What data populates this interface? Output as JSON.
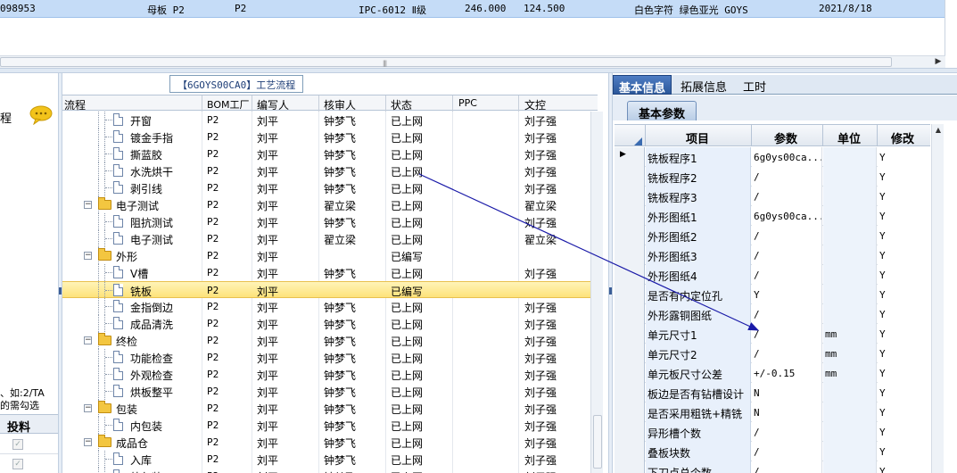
{
  "top_row": {
    "code": "098953",
    "name": "母板  P2",
    "factory": "P2",
    "material": "IPC-6012 Ⅱ级",
    "length": "246.000",
    "width": "124.500",
    "silk": "白色字符  绿色亚光  GOYS",
    "date": "2021/8/18"
  },
  "left_panel": {
    "label": "程",
    "note_line1": "、如:2/TA",
    "note_line2": "的需勾选",
    "column_header": "投料",
    "checks": [
      "✓",
      "✓"
    ]
  },
  "middle": {
    "title": "【6GOYS00CA0】工艺流程",
    "columns": [
      "流程",
      "BOM工厂",
      "编写人",
      "核审人",
      "状态",
      "PPC",
      "文控"
    ],
    "rows": [
      {
        "type": "child",
        "name": "开窗",
        "bom": "P2",
        "writer": "刘平",
        "reviewer": "钟梦飞",
        "status": "已上网",
        "ppc": "",
        "doc": "刘子强",
        "selected": false
      },
      {
        "type": "child",
        "name": "镀金手指",
        "bom": "P2",
        "writer": "刘平",
        "reviewer": "钟梦飞",
        "status": "已上网",
        "ppc": "",
        "doc": "刘子强",
        "selected": false
      },
      {
        "type": "child",
        "name": "撕蓝胶",
        "bom": "P2",
        "writer": "刘平",
        "reviewer": "钟梦飞",
        "status": "已上网",
        "ppc": "",
        "doc": "刘子强",
        "selected": false
      },
      {
        "type": "child",
        "name": "水洗烘干",
        "bom": "P2",
        "writer": "刘平",
        "reviewer": "钟梦飞",
        "status": "已上网",
        "ppc": "",
        "doc": "刘子强",
        "selected": false
      },
      {
        "type": "child",
        "name": "剥引线",
        "bom": "P2",
        "writer": "刘平",
        "reviewer": "钟梦飞",
        "status": "已上网",
        "ppc": "",
        "doc": "刘子强",
        "selected": false
      },
      {
        "type": "folder",
        "name": "电子测试",
        "bom": "P2",
        "writer": "刘平",
        "reviewer": "翟立梁",
        "status": "已上网",
        "ppc": "",
        "doc": "翟立梁",
        "selected": false
      },
      {
        "type": "child",
        "name": "阻抗测试",
        "bom": "P2",
        "writer": "刘平",
        "reviewer": "钟梦飞",
        "status": "已上网",
        "ppc": "",
        "doc": "刘子强",
        "selected": false
      },
      {
        "type": "child",
        "name": "电子测试",
        "bom": "P2",
        "writer": "刘平",
        "reviewer": "翟立梁",
        "status": "已上网",
        "ppc": "",
        "doc": "翟立梁",
        "selected": false
      },
      {
        "type": "folder",
        "name": "外形",
        "bom": "P2",
        "writer": "刘平",
        "reviewer": "",
        "status": "已编写",
        "ppc": "",
        "doc": "",
        "selected": false
      },
      {
        "type": "child",
        "name": "V槽",
        "bom": "P2",
        "writer": "刘平",
        "reviewer": "钟梦飞",
        "status": "已上网",
        "ppc": "",
        "doc": "刘子强",
        "selected": false
      },
      {
        "type": "child",
        "name": "铣板",
        "bom": "P2",
        "writer": "刘平",
        "reviewer": "",
        "status": "已编写",
        "ppc": "",
        "doc": "",
        "selected": true
      },
      {
        "type": "child",
        "name": "金指倒边",
        "bom": "P2",
        "writer": "刘平",
        "reviewer": "钟梦飞",
        "status": "已上网",
        "ppc": "",
        "doc": "刘子强",
        "selected": false
      },
      {
        "type": "child",
        "name": "成品清洗",
        "bom": "P2",
        "writer": "刘平",
        "reviewer": "钟梦飞",
        "status": "已上网",
        "ppc": "",
        "doc": "刘子强",
        "selected": false
      },
      {
        "type": "folder",
        "name": "终检",
        "bom": "P2",
        "writer": "刘平",
        "reviewer": "钟梦飞",
        "status": "已上网",
        "ppc": "",
        "doc": "刘子强",
        "selected": false
      },
      {
        "type": "child",
        "name": "功能检查",
        "bom": "P2",
        "writer": "刘平",
        "reviewer": "钟梦飞",
        "status": "已上网",
        "ppc": "",
        "doc": "刘子强",
        "selected": false
      },
      {
        "type": "child",
        "name": "外观检查",
        "bom": "P2",
        "writer": "刘平",
        "reviewer": "钟梦飞",
        "status": "已上网",
        "ppc": "",
        "doc": "刘子强",
        "selected": false
      },
      {
        "type": "child",
        "name": "烘板整平",
        "bom": "P2",
        "writer": "刘平",
        "reviewer": "钟梦飞",
        "status": "已上网",
        "ppc": "",
        "doc": "刘子强",
        "selected": false
      },
      {
        "type": "folder",
        "name": "包装",
        "bom": "P2",
        "writer": "刘平",
        "reviewer": "钟梦飞",
        "status": "已上网",
        "ppc": "",
        "doc": "刘子强",
        "selected": false
      },
      {
        "type": "child",
        "name": "内包装",
        "bom": "P2",
        "writer": "刘平",
        "reviewer": "钟梦飞",
        "status": "已上网",
        "ppc": "",
        "doc": "刘子强",
        "selected": false
      },
      {
        "type": "folder",
        "name": "成品仓",
        "bom": "P2",
        "writer": "刘平",
        "reviewer": "钟梦飞",
        "status": "已上网",
        "ppc": "",
        "doc": "刘子强",
        "selected": false
      },
      {
        "type": "child",
        "name": "入库",
        "bom": "P2",
        "writer": "刘平",
        "reviewer": "钟梦飞",
        "status": "已上网",
        "ppc": "",
        "doc": "刘子强",
        "selected": false
      },
      {
        "type": "child",
        "name": "外包装",
        "bom": "P2",
        "writer": "刘平",
        "reviewer": "钟梦飞",
        "status": "已上网",
        "ppc": "",
        "doc": "刘子强",
        "selected": false
      }
    ]
  },
  "right": {
    "tabs": [
      "基本信息",
      "拓展信息",
      "工时"
    ],
    "active_tab": 0,
    "subtab": "基本参数",
    "columns": [
      "项目",
      "参数",
      "单位",
      "修改"
    ],
    "rows": [
      {
        "item": "铣板程序1",
        "param": "6g0ys00ca...",
        "unit": "",
        "modify": "Y",
        "current": true
      },
      {
        "item": "铣板程序2",
        "param": "/",
        "unit": "",
        "modify": "Y",
        "current": false
      },
      {
        "item": "铣板程序3",
        "param": "/",
        "unit": "",
        "modify": "Y",
        "current": false
      },
      {
        "item": "外形图纸1",
        "param": "6g0ys00ca...",
        "unit": "",
        "modify": "Y",
        "current": false
      },
      {
        "item": "外形图纸2",
        "param": "/",
        "unit": "",
        "modify": "Y",
        "current": false
      },
      {
        "item": "外形图纸3",
        "param": "/",
        "unit": "",
        "modify": "Y",
        "current": false
      },
      {
        "item": "外形图纸4",
        "param": "/",
        "unit": "",
        "modify": "Y",
        "current": false
      },
      {
        "item": "是否有内定位孔",
        "param": "Y",
        "unit": "",
        "modify": "Y",
        "current": false
      },
      {
        "item": "外形露铜图纸",
        "param": "/",
        "unit": "",
        "modify": "Y",
        "current": false
      },
      {
        "item": "单元尺寸1",
        "param": "/",
        "unit": "mm",
        "modify": "Y",
        "current": false
      },
      {
        "item": "单元尺寸2",
        "param": "/",
        "unit": "mm",
        "modify": "Y",
        "current": false
      },
      {
        "item": "单元板尺寸公差",
        "param": "+/-0.15",
        "unit": "mm",
        "modify": "Y",
        "current": false
      },
      {
        "item": "板边是否有钻槽设计",
        "param": "N",
        "unit": "",
        "modify": "Y",
        "current": false
      },
      {
        "item": "是否采用粗铣+精铣",
        "param": "N",
        "unit": "",
        "modify": "Y",
        "current": false
      },
      {
        "item": "异形槽个数",
        "param": "/",
        "unit": "",
        "modify": "Y",
        "current": false
      },
      {
        "item": "叠板块数",
        "param": "/",
        "unit": "",
        "modify": "Y",
        "current": false
      },
      {
        "item": "下刀点总个数",
        "param": "/",
        "unit": "",
        "modify": "Y",
        "current": false
      }
    ]
  },
  "colors": {
    "selected_row": "#c5dcf7",
    "tree_highlight": "#fde27a",
    "tab_active": "#2b579a",
    "annotation_arrow": "#1a1aa8"
  },
  "icons": {
    "left_chat": "chat-bubble-icon",
    "tree_node": "document-icon",
    "tree_group": "folder-icon",
    "expand": "minus-icon",
    "row_pointer": "triangle-right-icon"
  }
}
